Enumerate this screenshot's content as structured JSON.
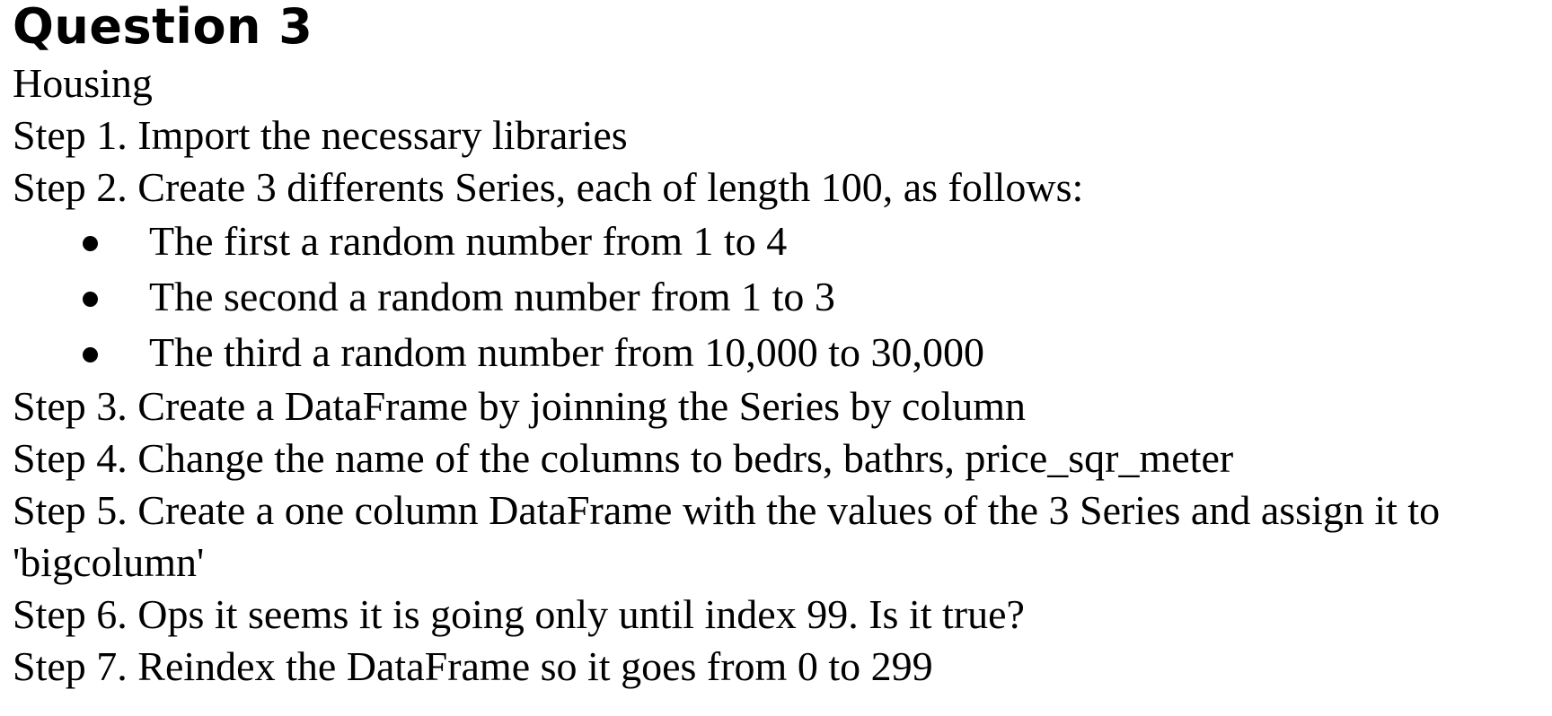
{
  "title": "Question 3",
  "subtitle": "Housing",
  "steps": {
    "s1": "Step 1. Import the necessary libraries",
    "s2": "Step 2. Create 3 differents Series, each of length 100, as follows:",
    "bullets": [
      "The first a random number from 1 to 4",
      "The second a random number from 1 to 3",
      "The third a random number from 10,000 to 30,000"
    ],
    "s3": "Step 3. Create a DataFrame by joinning the Series by column",
    "s4": "Step 4. Change the name of the columns to bedrs, bathrs, price_sqr_meter",
    "s5": "Step 5. Create a one column DataFrame with the values of the 3 Series and assign it to 'bigcolumn'",
    "s6": "Step 6. Ops it seems it is going only until index 99. Is it true?",
    "s7": "Step 7. Reindex the DataFrame so it goes from 0 to 299"
  }
}
